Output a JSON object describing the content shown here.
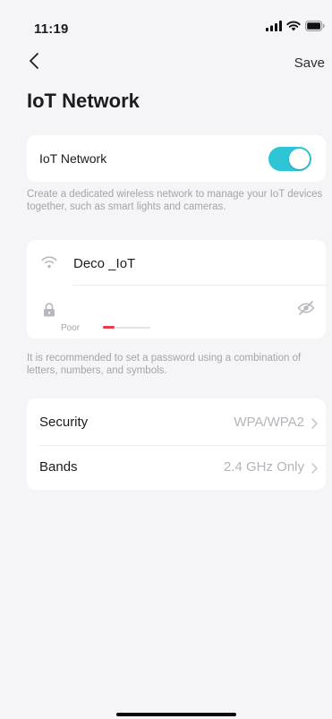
{
  "status_bar": {
    "time": "11:19",
    "icons": [
      "signal-icon",
      "wifi-icon",
      "battery-icon"
    ]
  },
  "nav": {
    "back_icon": "chevron-left-icon",
    "save_label": "Save"
  },
  "page": {
    "title": "IoT Network"
  },
  "iot_toggle": {
    "label": "IoT Network",
    "enabled": true,
    "accent_color": "#2ec6d6",
    "hint": "Create a dedicated wireless network to manage your IoT devices together, such as smart lights and cameras."
  },
  "credentials": {
    "ssid": "Deco _IoT",
    "password_value": "",
    "password_placeholder": "",
    "strength_label": "Poor",
    "strength_level": 0.25,
    "strength_color": "#ea3a4c",
    "hint": "It is recommended to set a password using a combination of letters, numbers, and symbols."
  },
  "settings": {
    "rows": [
      {
        "label": "Security",
        "value": "WPA/WPA2"
      },
      {
        "label": "Bands",
        "value": "2.4 GHz Only"
      }
    ]
  }
}
